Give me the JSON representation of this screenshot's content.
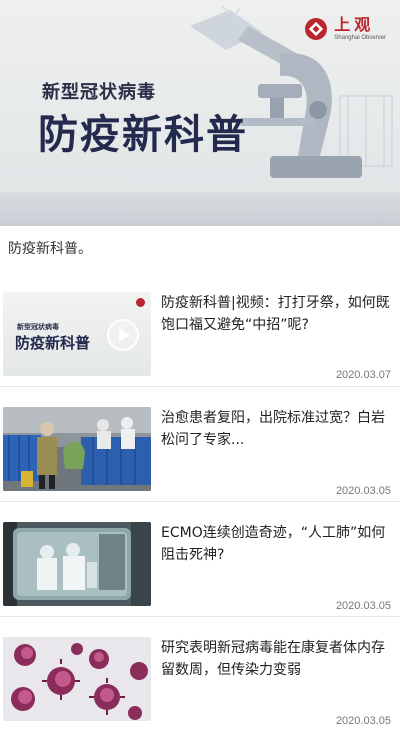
{
  "banner": {
    "brand_cn": "上观",
    "brand_en": "Shanghai Observer",
    "subtitle": "新型冠状病毒",
    "title": "防疫新科普"
  },
  "intro": "防疫新科普。",
  "articles": [
    {
      "title": "防疫新科普|视频：打打牙祭，如何既饱口福又避免“中招”呢?",
      "date": "2020.03.07",
      "thumb": {
        "subtitle": "新型冠状病毒",
        "title": "防疫新科普"
      }
    },
    {
      "title": "治愈患者复阳，出院标准过宽？白岩松问了专家...",
      "date": "2020.03.05"
    },
    {
      "title": "ECMO连续创造奇迹，“人工肺”如何阻击死神?",
      "date": "2020.03.05"
    },
    {
      "title": "研究表明新冠病毒能在康复者体内存留数周，但传染力变弱",
      "date": "2020.03.05"
    }
  ],
  "colors": {
    "brand_red": "#b9262d",
    "title_navy": "#232a4e",
    "date_gray": "#777777"
  }
}
